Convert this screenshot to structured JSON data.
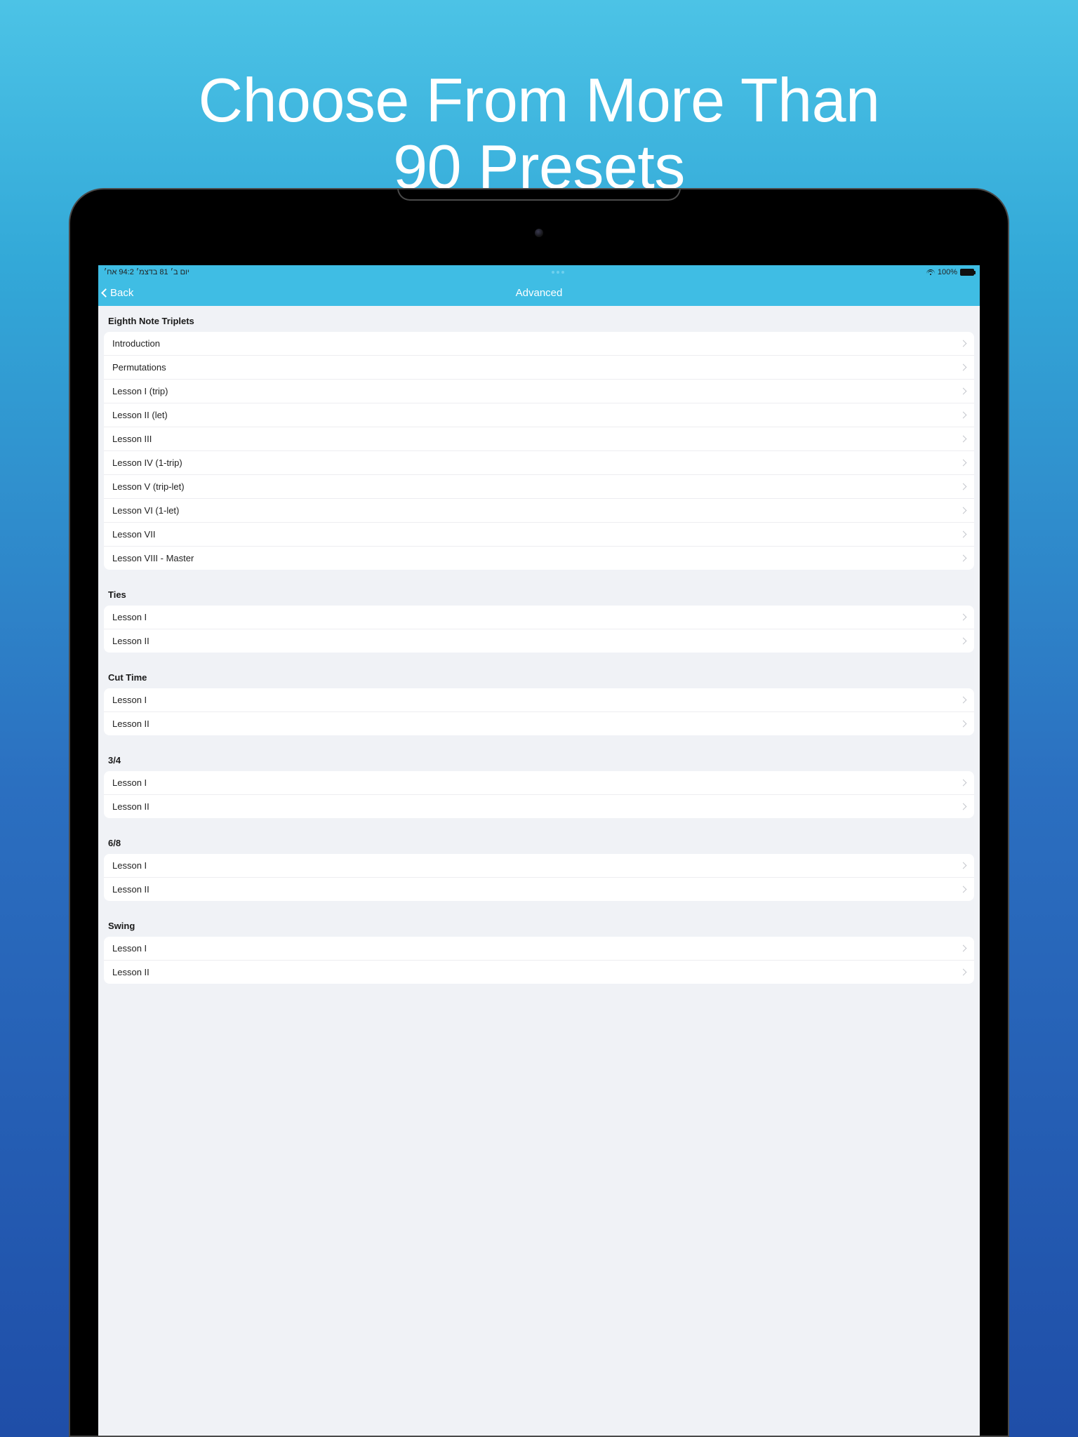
{
  "hero": {
    "line1": "Choose From More Than",
    "line2": "90 Presets"
  },
  "statusbar": {
    "left": "יום ב׳ 18 בדצמ׳ 2:49 אח׳",
    "battery_pct": "100%"
  },
  "navbar": {
    "back_label": "Back",
    "title": "Advanced"
  },
  "sections": [
    {
      "header": "Eighth Note Triplets",
      "rows": [
        "Introduction",
        "Permutations",
        "Lesson I (trip)",
        "Lesson II (let)",
        "Lesson III",
        "Lesson IV (1-trip)",
        "Lesson V (trip-let)",
        "Lesson VI (1-let)",
        "Lesson VII",
        "Lesson VIII - Master"
      ]
    },
    {
      "header": "Ties",
      "rows": [
        "Lesson I",
        "Lesson II"
      ]
    },
    {
      "header": "Cut Time",
      "rows": [
        "Lesson I",
        "Lesson II"
      ]
    },
    {
      "header": "3/4",
      "rows": [
        "Lesson I",
        "Lesson II"
      ]
    },
    {
      "header": "6/8",
      "rows": [
        "Lesson I",
        "Lesson II"
      ]
    },
    {
      "header": "Swing",
      "rows": [
        "Lesson I",
        "Lesson II"
      ]
    }
  ]
}
